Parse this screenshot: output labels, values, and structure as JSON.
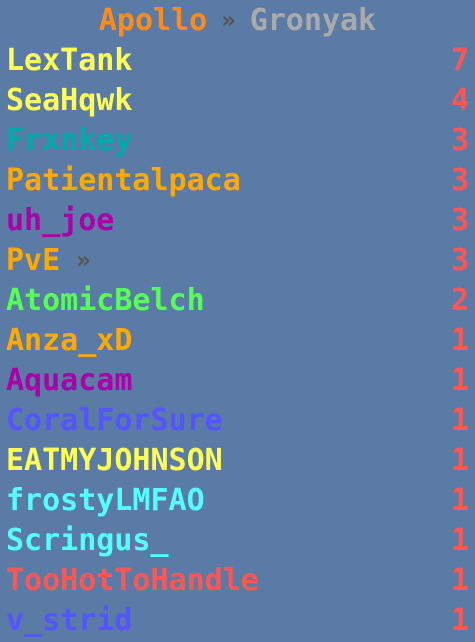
{
  "title": {
    "server": "Apollo",
    "server_color": "#ff8c1a",
    "separator": "»",
    "separator_color": "#555555",
    "subtitle": "Gronyak",
    "subtitle_color": "#aaaaaa"
  },
  "score_color": "#ff5555",
  "suffix_color": "#555555",
  "entries": [
    {
      "name": "LexTank",
      "color": "#ffff55",
      "suffix": "",
      "score": "7"
    },
    {
      "name": "SeaHqwk",
      "color": "#ffff55",
      "suffix": "",
      "score": "4"
    },
    {
      "name": "Frxnkey",
      "color": "#00aaaa",
      "suffix": "",
      "score": "3"
    },
    {
      "name": "Patientalpaca",
      "color": "#ffaa00",
      "suffix": "",
      "score": "3"
    },
    {
      "name": "uh_joe",
      "color": "#aa00aa",
      "suffix": "",
      "score": "3"
    },
    {
      "name": "PvE",
      "color": "#ffaa00",
      "suffix": "»",
      "score": "3"
    },
    {
      "name": "AtomicBelch",
      "color": "#55ff55",
      "suffix": "",
      "score": "2"
    },
    {
      "name": "Anza_xD",
      "color": "#ffaa00",
      "suffix": "",
      "score": "1"
    },
    {
      "name": "Aquacam",
      "color": "#aa00aa",
      "suffix": "",
      "score": "1"
    },
    {
      "name": "CoralForSure",
      "color": "#5555ff",
      "suffix": "",
      "score": "1"
    },
    {
      "name": "EATMYJOHNSON",
      "color": "#ffff55",
      "suffix": "",
      "score": "1"
    },
    {
      "name": "frostyLMFAO",
      "color": "#55ffff",
      "suffix": "",
      "score": "1"
    },
    {
      "name": "Scringus_",
      "color": "#55ffff",
      "suffix": "",
      "score": "1"
    },
    {
      "name": "TooHotToHandle",
      "color": "#ff5555",
      "suffix": "",
      "score": "1"
    },
    {
      "name": "v_strid",
      "color": "#5555ff",
      "suffix": "",
      "score": "1"
    }
  ]
}
